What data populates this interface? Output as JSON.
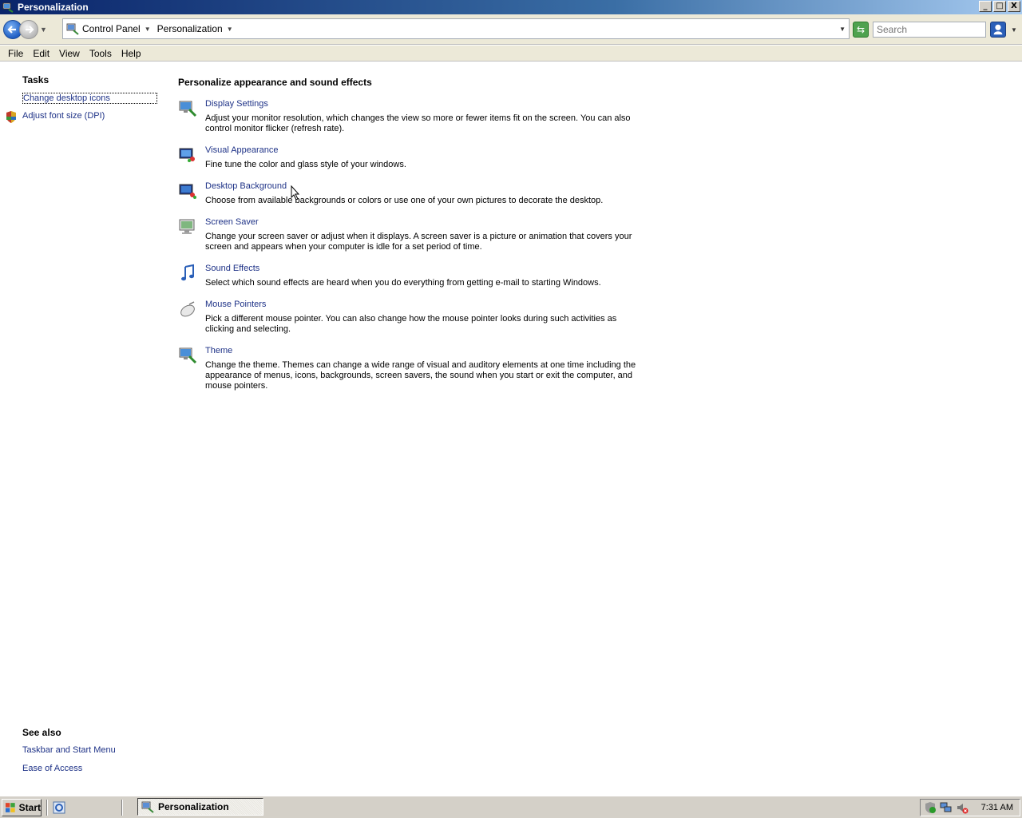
{
  "window": {
    "title": "Personalization",
    "buttons": {
      "minimize": "_",
      "maximize": "□",
      "close": "X"
    }
  },
  "address": {
    "crumbs": [
      "Control Panel",
      "Personalization"
    ],
    "search_placeholder": "Search"
  },
  "menu": [
    "File",
    "Edit",
    "View",
    "Tools",
    "Help"
  ],
  "sidebar": {
    "tasks_heading": "Tasks",
    "tasks": [
      "Change desktop icons",
      "Adjust font size (DPI)"
    ],
    "see_also_heading": "See also",
    "see_also": [
      "Taskbar and Start Menu",
      "Ease of Access"
    ]
  },
  "main": {
    "heading": "Personalize appearance and sound effects",
    "items": [
      {
        "title": "Display Settings",
        "icon": "display-settings-icon",
        "desc": "Adjust your monitor resolution, which changes the view so more or fewer items fit on the screen. You can also control monitor flicker (refresh rate)."
      },
      {
        "title": "Visual Appearance",
        "icon": "visual-appearance-icon",
        "desc": "Fine tune the color and glass style of your windows."
      },
      {
        "title": "Desktop Background",
        "icon": "desktop-background-icon",
        "desc": "Choose from available backgrounds or colors or use one of your own pictures to decorate the desktop."
      },
      {
        "title": "Screen Saver",
        "icon": "screen-saver-icon",
        "desc": "Change your screen saver or adjust when it displays. A screen saver is a picture or animation that covers your screen and appears when your computer is idle for a set period of time."
      },
      {
        "title": "Sound Effects",
        "icon": "music-note-icon",
        "desc": "Select which sound effects are heard when you do everything from getting e-mail to starting Windows."
      },
      {
        "title": "Mouse Pointers",
        "icon": "mouse-icon",
        "desc": "Pick a different mouse pointer. You can also change how the mouse pointer looks during such activities as clicking and selecting."
      },
      {
        "title": "Theme",
        "icon": "theme-icon",
        "desc": "Change the theme. Themes can change a wide range of visual and auditory elements at one time including the appearance of menus, icons, backgrounds, screen savers, the sound when you start or exit the computer, and mouse pointers."
      }
    ]
  },
  "taskbar": {
    "start_label": "Start",
    "tasks": [
      "Personalization"
    ],
    "clock": "7:31 AM"
  },
  "colors": {
    "link": "#1e3287",
    "titlebar_start": "#0a246a",
    "titlebar_end": "#a6caf0",
    "chrome": "#d4d0c8"
  }
}
